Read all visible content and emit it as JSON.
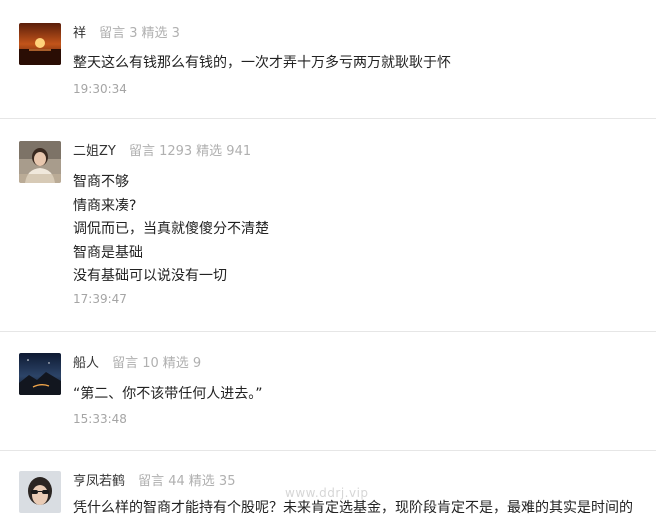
{
  "comments": [
    {
      "nickname": "祥",
      "stats": {
        "messages_label": "留言 3",
        "featured_label": "精选 3"
      },
      "lines": [
        "整天这么有钱那么有钱的，一次才弄十万多亏两万就耿耿于怀"
      ],
      "time": "19:30:34",
      "avatar_icon": "sunset-photo-avatar"
    },
    {
      "nickname": "二姐ZY",
      "stats": {
        "messages_label": "留言 1293",
        "featured_label": "精选 941"
      },
      "lines": [
        "智商不够",
        "情商来凑?",
        "调侃而已，当真就傻傻分不清楚",
        "智商是基础",
        "没有基础可以说没有一切"
      ],
      "time": "17:39:47",
      "avatar_icon": "woman-portrait-avatar"
    },
    {
      "nickname": "船人",
      "stats": {
        "messages_label": "留言 10",
        "featured_label": "精选 9"
      },
      "lines": [
        "“第二、你不该带任何人进去。”"
      ],
      "time": "15:33:48",
      "avatar_icon": "night-landscape-avatar"
    },
    {
      "nickname": "亨凤若鹤",
      "stats": {
        "messages_label": "留言 44",
        "featured_label": "精选 35"
      },
      "lines": [
        "凭什么样的智商才能持有个股呢？未来肯定选基金，现阶段肯定不是，最难的其实是时间的"
      ],
      "time": "",
      "avatar_icon": "sunglasses-portrait-avatar"
    }
  ],
  "watermark": "www.ddrj.vip",
  "colors": {
    "meta_gray": "#b0b0b0",
    "time_gray": "#a5a5a5",
    "divider": "#e6e6e6"
  }
}
